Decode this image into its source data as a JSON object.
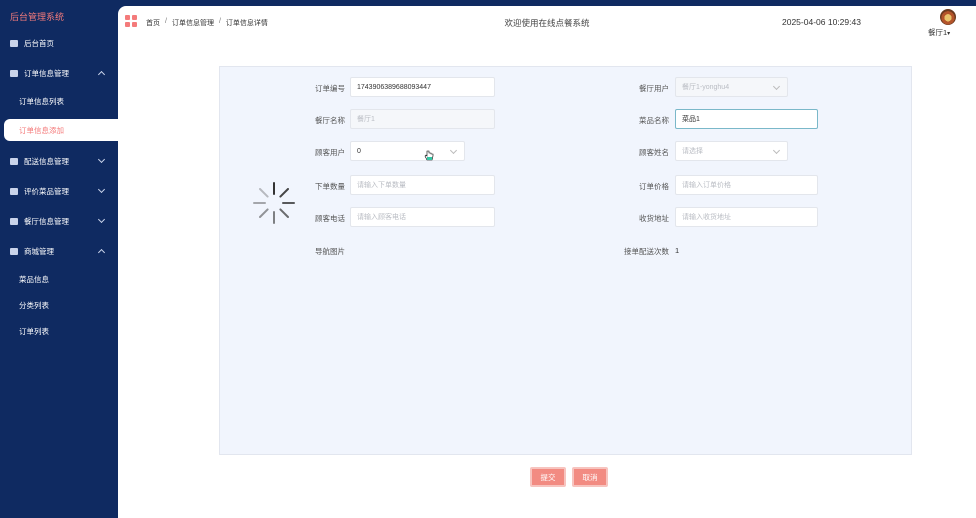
{
  "brand": "后台管理系统",
  "sidebar": {
    "items": [
      {
        "label": "后台首页"
      },
      {
        "label": "订单信息管理"
      },
      {
        "label": "订单信息列表"
      },
      {
        "label": "订单信息添加"
      },
      {
        "label": "配送信息管理"
      },
      {
        "label": "评价菜品管理"
      },
      {
        "label": "餐厅信息管理"
      },
      {
        "label": "商城管理"
      },
      {
        "label": "菜品信息"
      },
      {
        "label": "分类列表"
      },
      {
        "label": "订单列表"
      }
    ]
  },
  "header": {
    "breadcrumb": [
      "首页",
      "订单信息管理",
      "订单信息详情"
    ],
    "breadcrumb_sep": "/",
    "welcome": "欢迎使用在线点餐系统",
    "datetime": "2025-04-06 10:29:43",
    "user": "餐厅1",
    "user_caret": "▾"
  },
  "form": {
    "order_no": {
      "label": "订单编号",
      "value": "1743906389688093447"
    },
    "restaurant_user": {
      "label": "餐厅用户",
      "value": "餐厅1-yonghu4"
    },
    "restaurant_name": {
      "label": "餐厅名称",
      "value": "餐厅1"
    },
    "dish_name": {
      "label": "菜品名称",
      "value": "菜品1"
    },
    "customer_user": {
      "label": "顾客用户",
      "value": "0"
    },
    "customer_name": {
      "label": "顾客姓名",
      "placeholder": "请选择"
    },
    "quantity": {
      "label": "下单数量",
      "placeholder": "请输入下单数量"
    },
    "price": {
      "label": "订单价格",
      "placeholder": "请输入订单价格"
    },
    "phone": {
      "label": "顾客电话",
      "placeholder": "请输入顾客电话"
    },
    "address": {
      "label": "收货地址",
      "placeholder": "请输入收货地址"
    },
    "image": {
      "label": "导航图片"
    },
    "delivery_times": {
      "label": "接单配送次数",
      "value": "1"
    }
  },
  "buttons": {
    "submit": "提交",
    "cancel": "取消"
  },
  "colors": {
    "sidebar_bg": "#0f2a61",
    "accent": "#f47b7b",
    "button": "#f28b82",
    "panel_bg": "#f1f5fd"
  },
  "icons": {
    "grid": "grid-icon",
    "spinner": "loading-spinner-icon",
    "cursor": "hand-cursor-icon"
  }
}
